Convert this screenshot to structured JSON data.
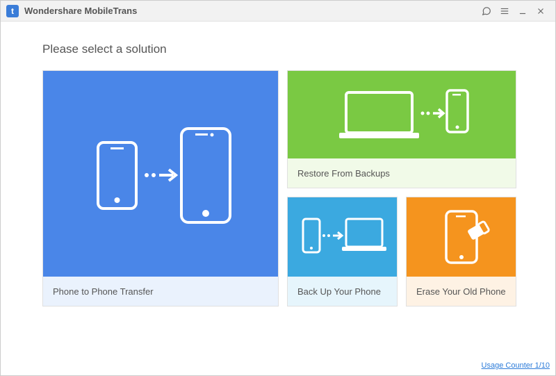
{
  "app": {
    "title": "Wondershare MobileTrans",
    "logo_letter": "t"
  },
  "subtitle": "Please select a solution",
  "cards": {
    "transfer": {
      "label": "Phone to Phone Transfer"
    },
    "restore": {
      "label": "Restore From Backups"
    },
    "backup": {
      "label": "Back Up Your Phone"
    },
    "erase": {
      "label": "Erase Your Old Phone"
    }
  },
  "footer": {
    "usage_text": "Usage Counter 1/10"
  },
  "colors": {
    "blue": "#4a86e8",
    "green": "#7ac943",
    "cyan": "#3ba9e0",
    "orange": "#f5941e"
  }
}
